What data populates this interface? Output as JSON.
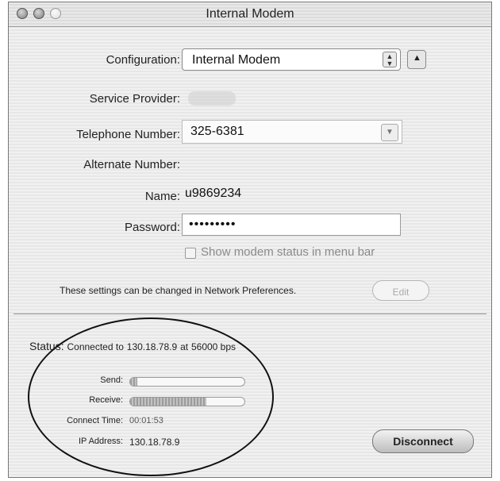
{
  "window": {
    "title": "Internal Modem"
  },
  "form": {
    "configuration_label": "Configuration:",
    "configuration_value": "Internal Modem",
    "service_provider_label": "Service Provider:",
    "telephone_label": "Telephone Number:",
    "telephone_value": "325-6381",
    "alternate_label": "Alternate Number:",
    "name_label": "Name:",
    "name_value": "u9869234",
    "password_label": "Password:",
    "password_value": "•••••••••",
    "show_status_label": "Show modem status in menu bar",
    "show_status_checked": false,
    "settings_note": "These settings can be changed in Network Preferences.",
    "edit_label": "Edit"
  },
  "status": {
    "status_label": "Status:",
    "status_text": "Connected to",
    "ip": "130.18.78.9",
    "at": "at",
    "speed": "56000 bps",
    "send_label": "Send:",
    "send_level": 0.06,
    "receive_label": "Receive:",
    "receive_level": 0.67,
    "connect_time_label": "Connect Time:",
    "connect_time_value": "00:01:53",
    "ip_address_label": "IP Address:",
    "ip_address_value": "130.18.78.9",
    "disconnect_label": "Disconnect"
  }
}
